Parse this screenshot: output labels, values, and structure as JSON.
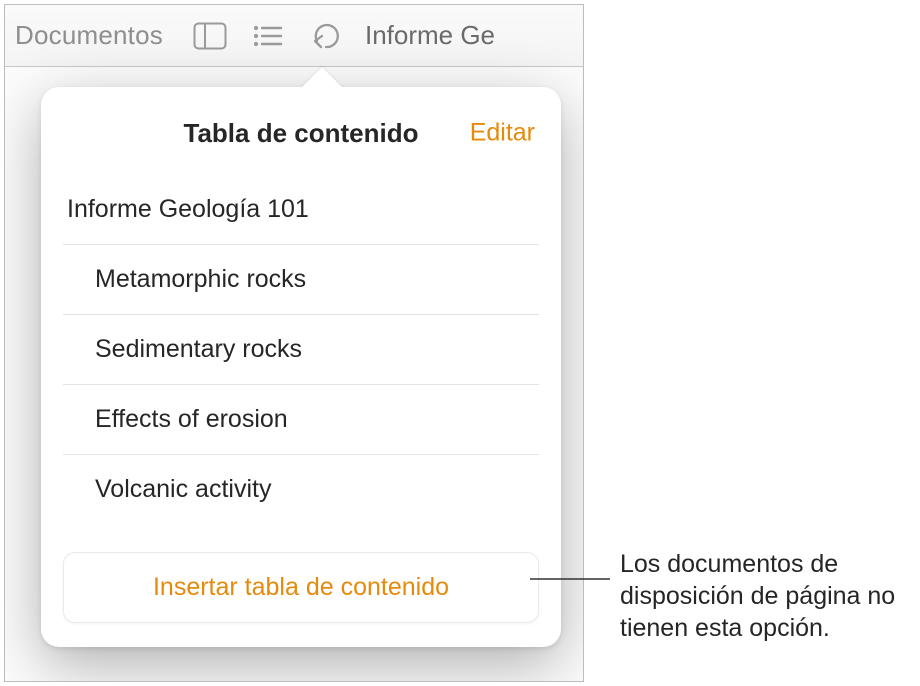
{
  "toolbar": {
    "nav_label": "Documentos",
    "doc_title": "Informe Ge"
  },
  "popover": {
    "title": "Tabla de contenido",
    "edit_label": "Editar",
    "items": [
      {
        "label": "Informe Geología 101"
      },
      {
        "label": "Metamorphic rocks"
      },
      {
        "label": "Sedimentary rocks"
      },
      {
        "label": "Effects of erosion"
      },
      {
        "label": "Volcanic activity"
      }
    ],
    "insert_label": "Insertar tabla de contenido"
  },
  "callout": {
    "text": "Los documentos de disposición de página no tienen esta opción."
  }
}
